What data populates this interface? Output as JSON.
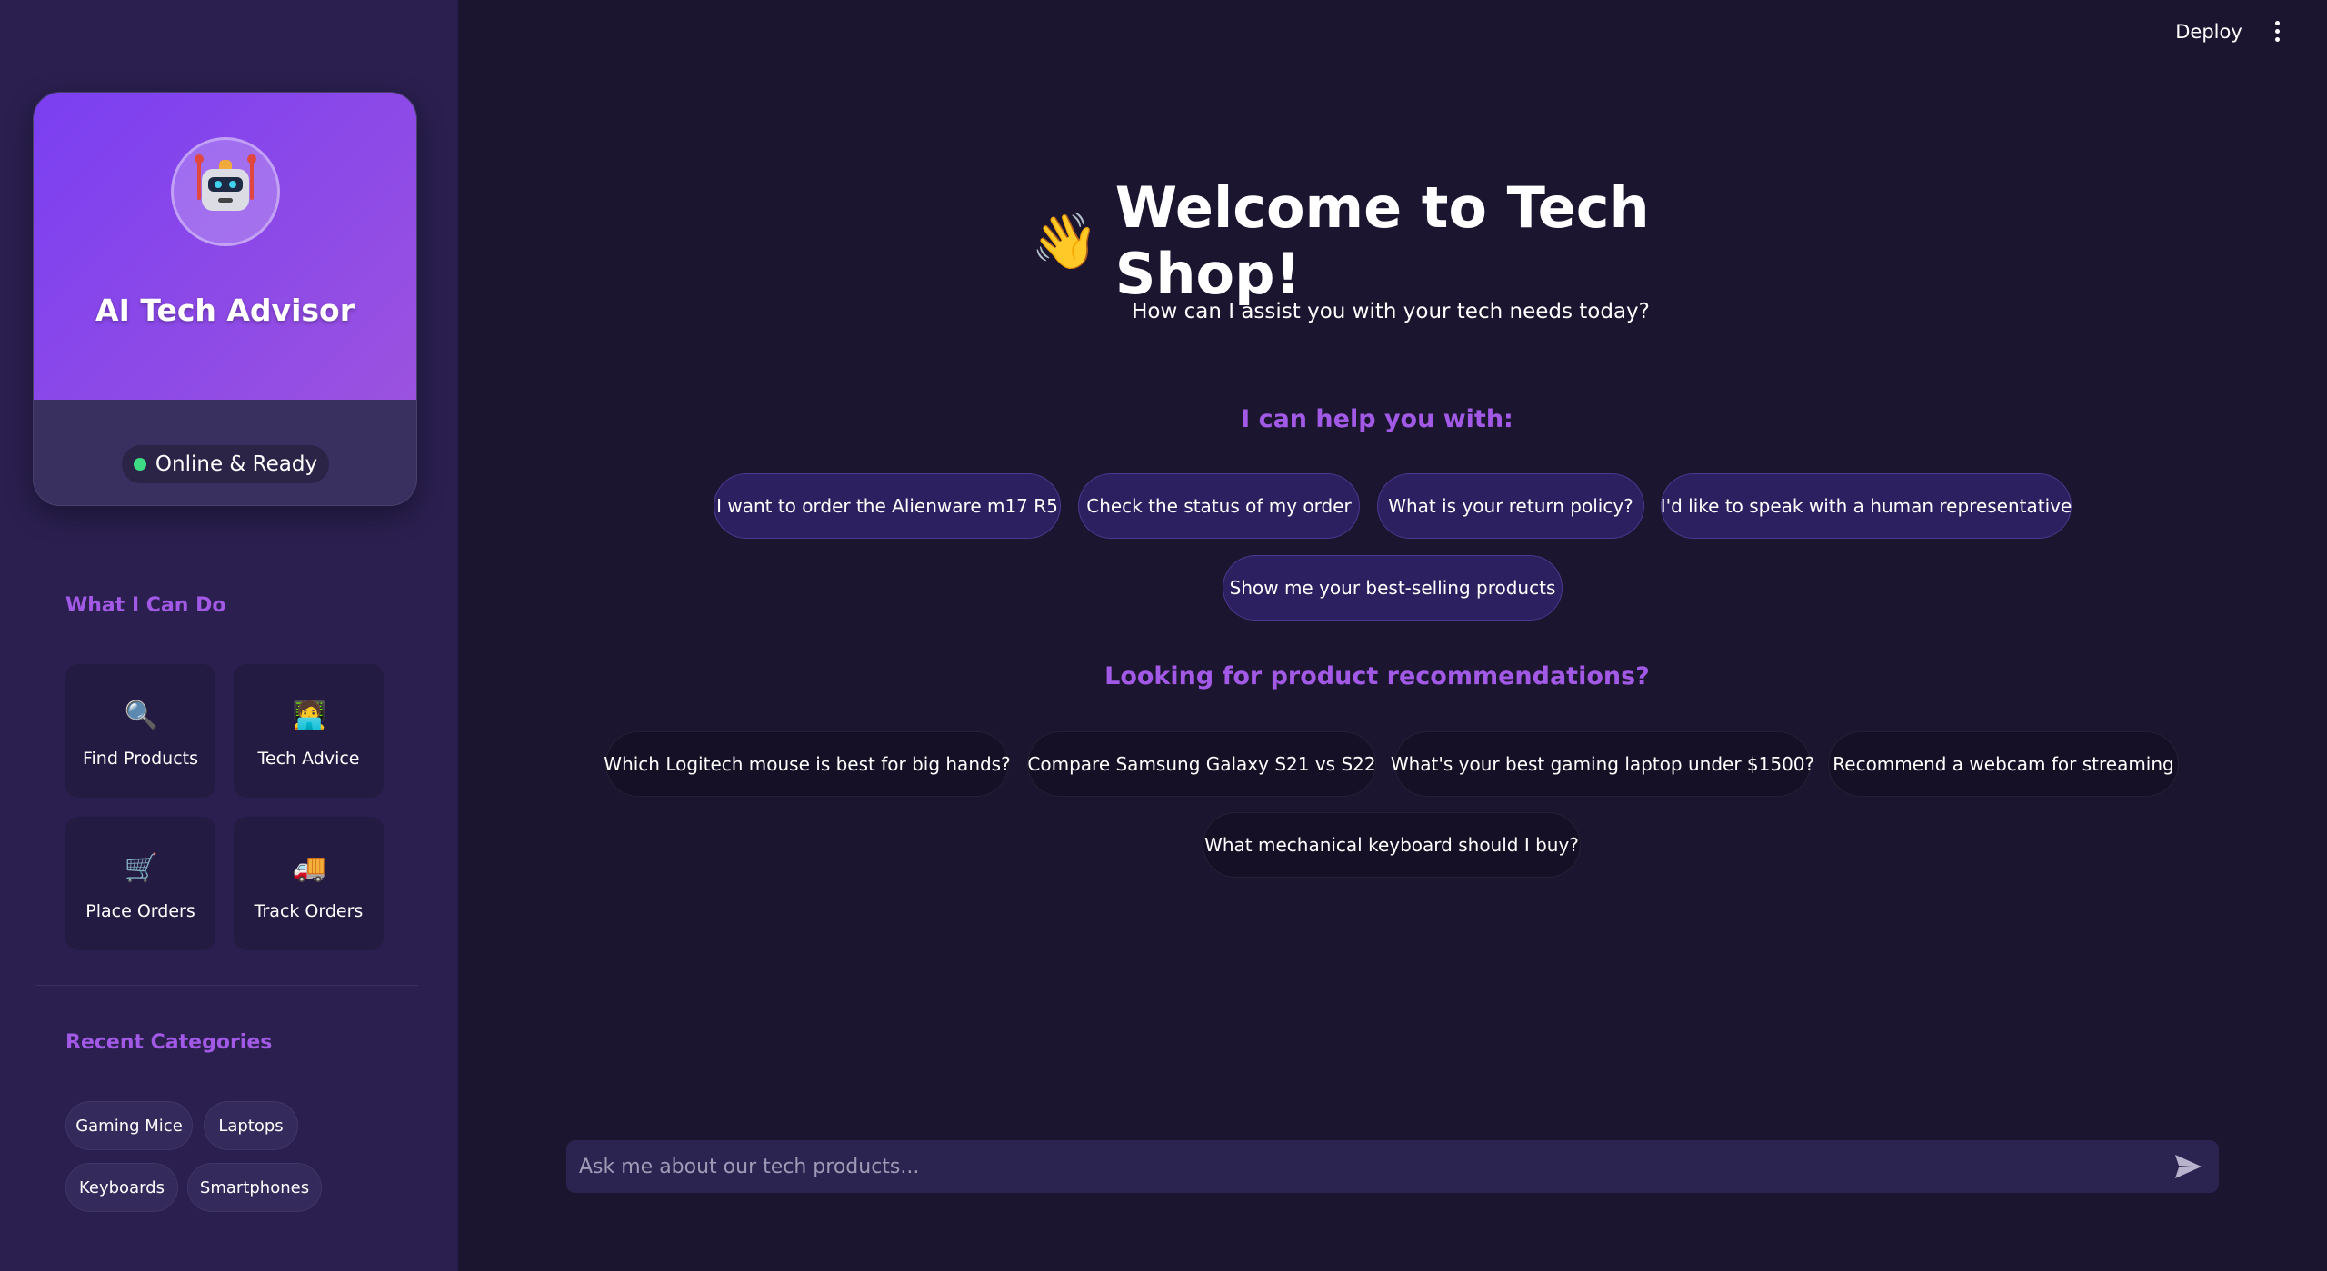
{
  "header": {
    "deploy_label": "Deploy",
    "menu_icon": "kebab-menu-icon"
  },
  "sidebar": {
    "profile": {
      "name": "AI Tech Advisor",
      "avatar_icon": "robot-icon",
      "status": "Online & Ready",
      "status_color": "#3ddc84"
    },
    "capabilities_title": "What I Can Do",
    "capabilities": [
      {
        "label": "Find Products",
        "icon": "magnifier-icon",
        "glyph": "🔍"
      },
      {
        "label": "Tech Advice",
        "icon": "technologist-icon",
        "glyph": "🧑‍💻"
      },
      {
        "label": "Place Orders",
        "icon": "shopping-cart-icon",
        "glyph": "🛒"
      },
      {
        "label": "Track Orders",
        "icon": "delivery-truck-icon",
        "glyph": "🚚"
      }
    ],
    "categories_title": "Recent Categories",
    "categories": [
      "Gaming Mice",
      "Laptops",
      "Keyboards",
      "Smartphones"
    ]
  },
  "main": {
    "welcome_emoji": "👋",
    "welcome_title": "Welcome to Tech Shop!",
    "welcome_subtitle": "How can I assist you with your tech needs today?",
    "help_title": "I can help you with:",
    "help_prompts": [
      "I want to order the Alienware m17 R5",
      "Check the status of my order",
      "What is your return policy?",
      "I'd like to speak with a human representative",
      "Show me your best-selling products"
    ],
    "reco_title": "Looking for product recommendations?",
    "reco_prompts": [
      "Which Logitech mouse is best for big hands?",
      "Compare Samsung Galaxy S21 vs S22",
      "What's your best gaming laptop under $1500?",
      "Recommend a webcam for streaming",
      "What mechanical keyboard should I buy?"
    ]
  },
  "chat": {
    "placeholder": "Ask me about our tech products...",
    "value": "",
    "send_icon": "send-icon"
  },
  "theme": {
    "background": "#1b1530",
    "sidebar": "#2a1f4f",
    "accent": "#a25ae6",
    "gradient_start": "#7b3ff2",
    "gradient_end": "#9b52df"
  }
}
